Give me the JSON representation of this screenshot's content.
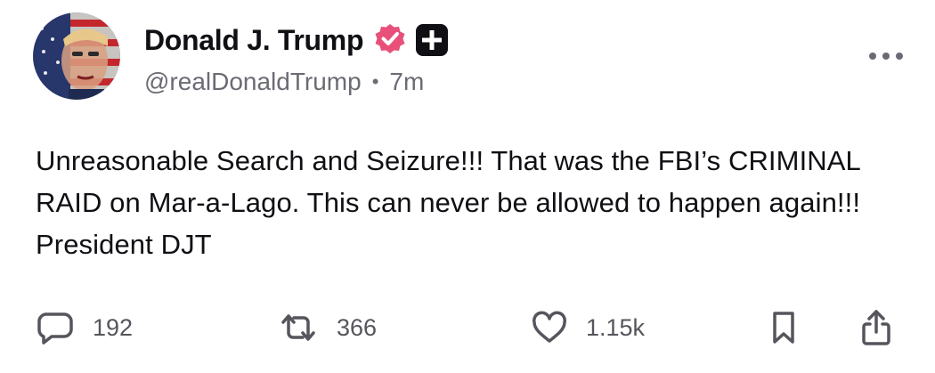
{
  "post": {
    "author": {
      "display_name": "Donald J. Trump",
      "handle": "@realDonaldTrump",
      "separator": "•",
      "timestamp": "7m",
      "verified": true,
      "verified_color": "#e8507a"
    },
    "content": {
      "text": "Unreasonable Search and Seizure!!! That was the FBI’s CRIMINAL RAID on Mar-a-Lago. This can never be allowed to happen again!!! President DJT"
    },
    "actions": {
      "replies": {
        "icon": "comment-icon",
        "count": "192"
      },
      "reposts": {
        "icon": "repost-icon",
        "count": "366"
      },
      "likes": {
        "icon": "heart-icon",
        "count": "1.15k"
      },
      "bookmark": {
        "icon": "bookmark-icon"
      },
      "share": {
        "icon": "share-icon"
      }
    },
    "more": {
      "icon": "more-options-icon"
    }
  }
}
